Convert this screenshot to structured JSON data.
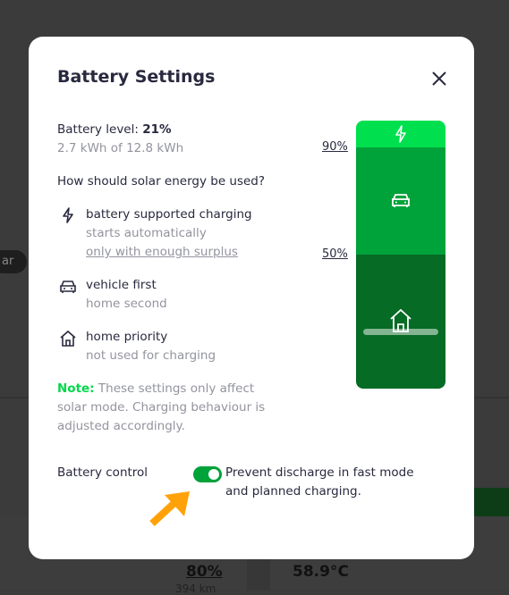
{
  "background": {
    "pill_text": "ar",
    "value_1": "80%",
    "value_1_sub": "394 km",
    "value_2": "58.9°C"
  },
  "modal": {
    "title": "Battery Settings",
    "battery_level_label": "Battery level:",
    "battery_level_value": "21%",
    "energy": "2.7 kWh of 12.8 kWh",
    "question": "How should solar energy be used?",
    "options": [
      {
        "icon": "lightning-icon",
        "title": "battery supported charging",
        "line1": "starts automatically",
        "link": "only with enough surplus"
      },
      {
        "icon": "car-icon",
        "title": "vehicle first",
        "line1": "home second"
      },
      {
        "icon": "home-icon",
        "title": "home priority",
        "line1": "not used for charging"
      }
    ],
    "note_label": "Note:",
    "note_lines": [
      "These settings only affect",
      "solar mode. Charging behaviour is",
      "adjusted accordingly."
    ],
    "thresholds": {
      "upper": "90%",
      "lower": "50%"
    },
    "battery_level_fraction": 0.21,
    "control_label": "Battery control",
    "control_text_lines": [
      "Prevent discharge in fast mode",
      "and planned charging."
    ],
    "control_enabled": true,
    "colors": {
      "top": "#00e04f",
      "middle": "#00a23a",
      "bottom": "#066b25",
      "note": "#00d84a",
      "arrow": "#ffa20a"
    }
  }
}
